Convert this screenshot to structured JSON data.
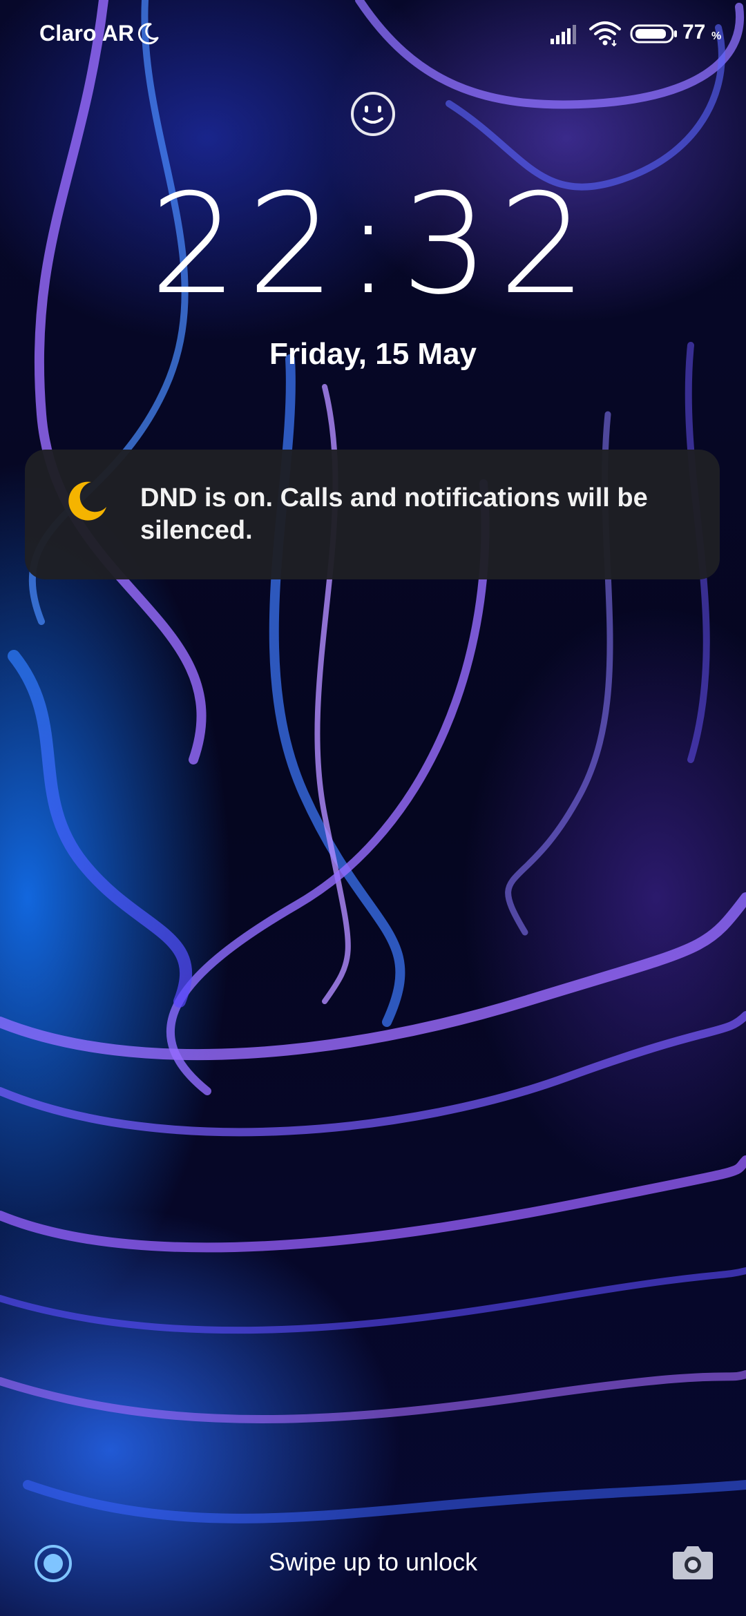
{
  "status_bar": {
    "carrier": "Claro AR",
    "carrier_icon": "moon-icon",
    "signal_icon": "signal-icon",
    "wifi_icon": "wifi-icon",
    "battery_icon": "battery-icon",
    "battery_level": "77",
    "battery_unit": "%"
  },
  "lock_screen": {
    "face_unlock_icon": "face-icon",
    "time": "22:32",
    "date": "Friday, 15 May"
  },
  "notification": {
    "icon": "moon-icon",
    "icon_color": "#f5b400",
    "text": "DND is on. Calls and notifications will be silenced."
  },
  "bottom_bar": {
    "left_icon": "assistant-icon",
    "hint": "Swipe up to unlock",
    "right_icon": "camera-icon"
  }
}
